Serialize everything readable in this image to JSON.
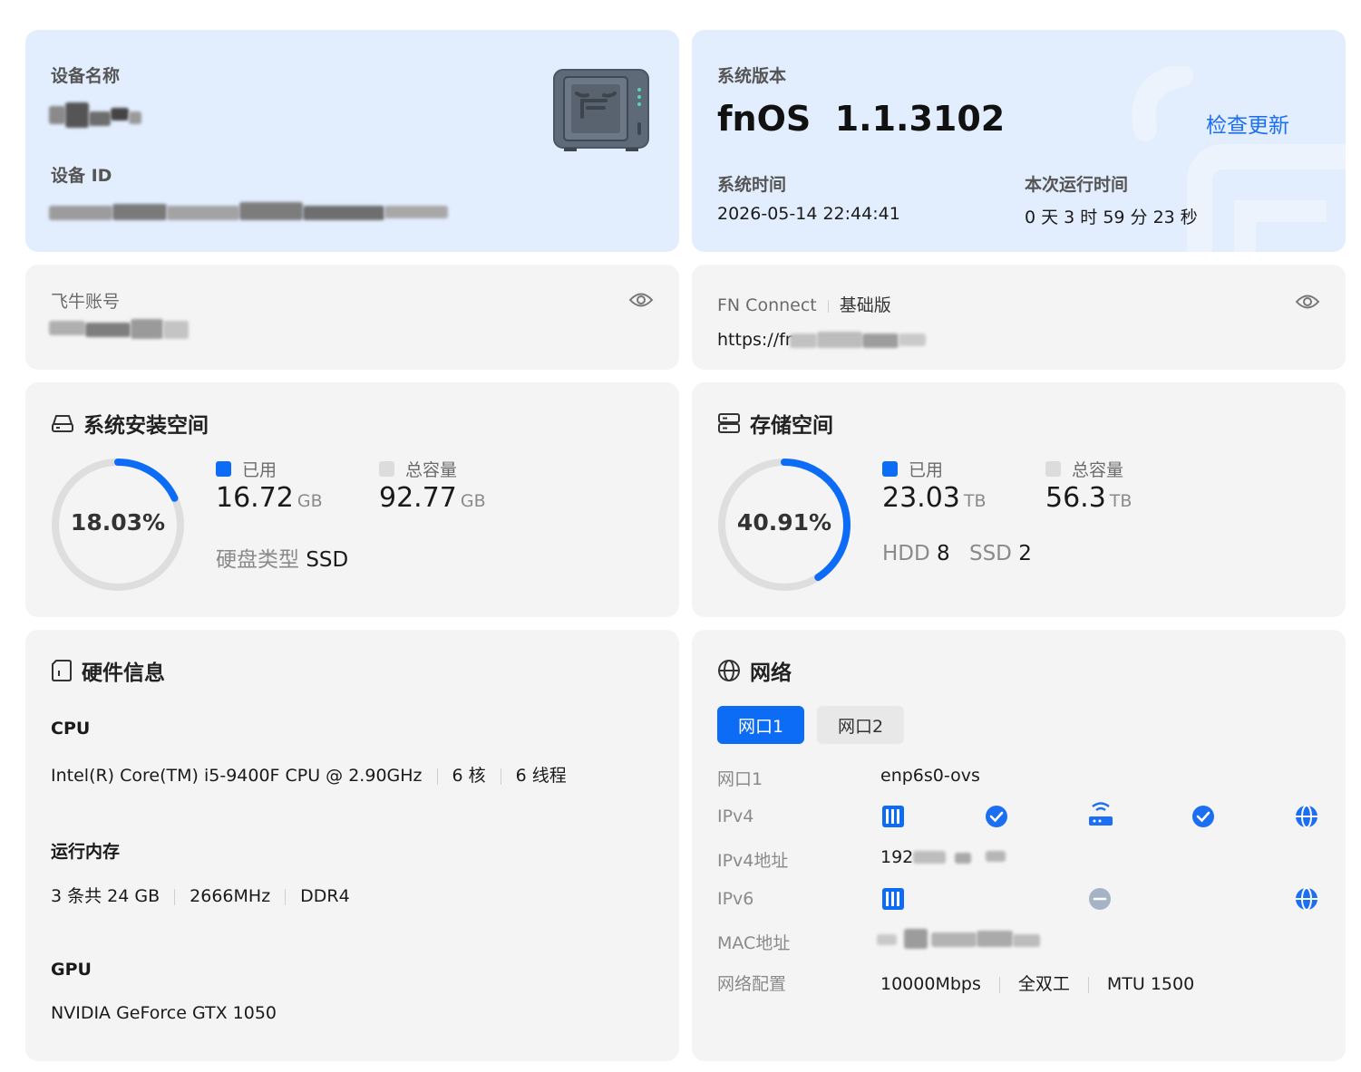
{
  "device": {
    "name_label": "设备名称",
    "id_label": "设备 ID"
  },
  "system": {
    "version_label": "系统版本",
    "version": "fnOS  1.1.3102",
    "check_update": "检查更新",
    "time_label": "系统时间",
    "time_value": "2026-05-14 22:44:41",
    "uptime_label": "本次运行时间",
    "uptime_value": "0 天 3 时 59 分 23 秒"
  },
  "account": {
    "label": "飞牛账号"
  },
  "fn_connect": {
    "label": "FN Connect",
    "tier": "基础版",
    "url_prefix": "https://fn"
  },
  "system_disk": {
    "title": "系统安装空间",
    "percent": 18.03,
    "percent_text": "18.03%",
    "used_label": "已用",
    "used_value": "16.72",
    "used_unit": "GB",
    "total_label": "总容量",
    "total_value": "92.77",
    "total_unit": "GB",
    "disk_type_label": "硬盘类型",
    "disk_type_value": "SSD"
  },
  "storage": {
    "title": "存储空间",
    "percent": 40.91,
    "percent_text": "40.91%",
    "used_label": "已用",
    "used_value": "23.03",
    "used_unit": "TB",
    "total_label": "总容量",
    "total_value": "56.3",
    "total_unit": "TB",
    "hdd_label": "HDD",
    "hdd_count": "8",
    "ssd_label": "SSD",
    "ssd_count": "2"
  },
  "hardware": {
    "title": "硬件信息",
    "cpu_label": "CPU",
    "cpu_model": "Intel(R) Core(TM) i5-9400F CPU @ 2.90GHz",
    "cpu_cores": "6 核",
    "cpu_threads": "6 线程",
    "mem_label": "运行内存",
    "mem_size": "3 条共 24 GB",
    "mem_speed": "2666MHz",
    "mem_type": "DDR4",
    "gpu_label": "GPU",
    "gpu_model": "NVIDIA GeForce GTX 1050"
  },
  "network": {
    "title": "网络",
    "tabs": [
      "网口1",
      "网口2"
    ],
    "port_label": "网口1",
    "port_value": "enp6s0-ovs",
    "ipv4_label": "IPv4",
    "ipv4_addr_label": "IPv4地址",
    "ipv4_addr_prefix": "192",
    "ipv6_label": "IPv6",
    "mac_label": "MAC地址",
    "config_label": "网络配置",
    "speed": "10000Mbps",
    "duplex": "全双工",
    "mtu": "MTU 1500"
  },
  "colors": {
    "accent": "#0d6cf5",
    "ring_track": "#dedede",
    "card": "#f4f4f4",
    "card_blue": "#e2edfd"
  }
}
